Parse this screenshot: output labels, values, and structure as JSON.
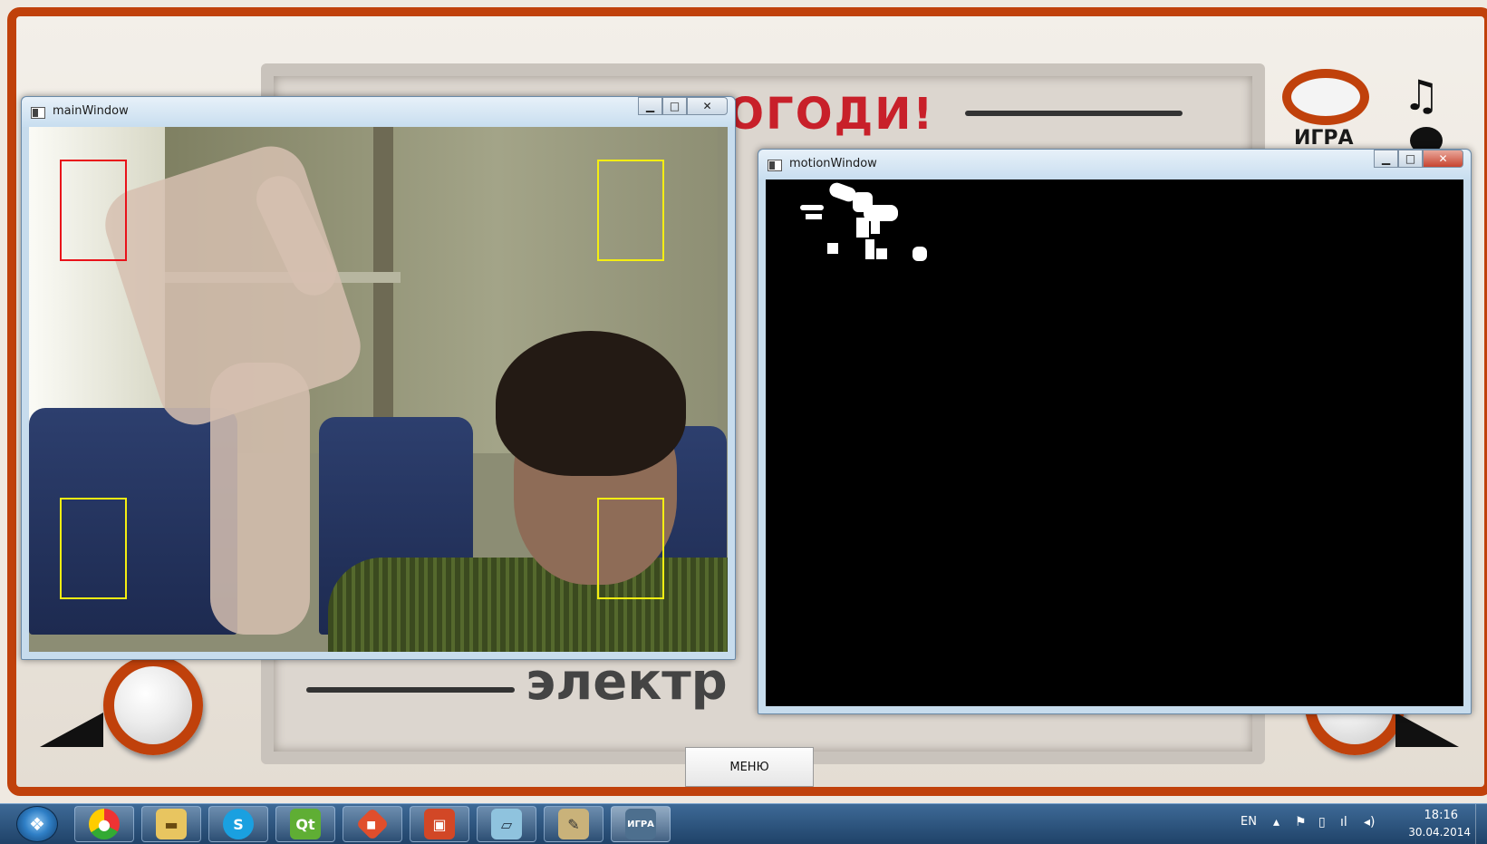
{
  "game": {
    "logo": "НУ, ПОГОДИ!",
    "brand": "электр",
    "igra_label": "ИГРА",
    "menu_label": "МЕНЮ",
    "music_icon": "music-note-icon",
    "colors": {
      "frame": "#c0410b",
      "logo": "#c8202a"
    }
  },
  "windows": {
    "main": {
      "title": "mainWindow"
    },
    "motion": {
      "title": "motionWindow"
    }
  },
  "taskbar": {
    "apps": [
      {
        "name": "chrome",
        "icon": "chrome-icon"
      },
      {
        "name": "explorer",
        "icon": "folder-icon"
      },
      {
        "name": "skype",
        "icon": "skype-icon",
        "label": "S"
      },
      {
        "name": "qt",
        "icon": "qt-icon",
        "label": "Qt"
      },
      {
        "name": "git",
        "icon": "git-icon"
      },
      {
        "name": "powerpoint",
        "icon": "presentation-icon"
      },
      {
        "name": "notebook",
        "icon": "notebook-icon"
      },
      {
        "name": "paint",
        "icon": "paint-icon"
      },
      {
        "name": "igra",
        "icon": "game-icon",
        "label": "ИГРА"
      }
    ],
    "language": "EN",
    "time": "18:16",
    "date": "30.04.2014"
  }
}
